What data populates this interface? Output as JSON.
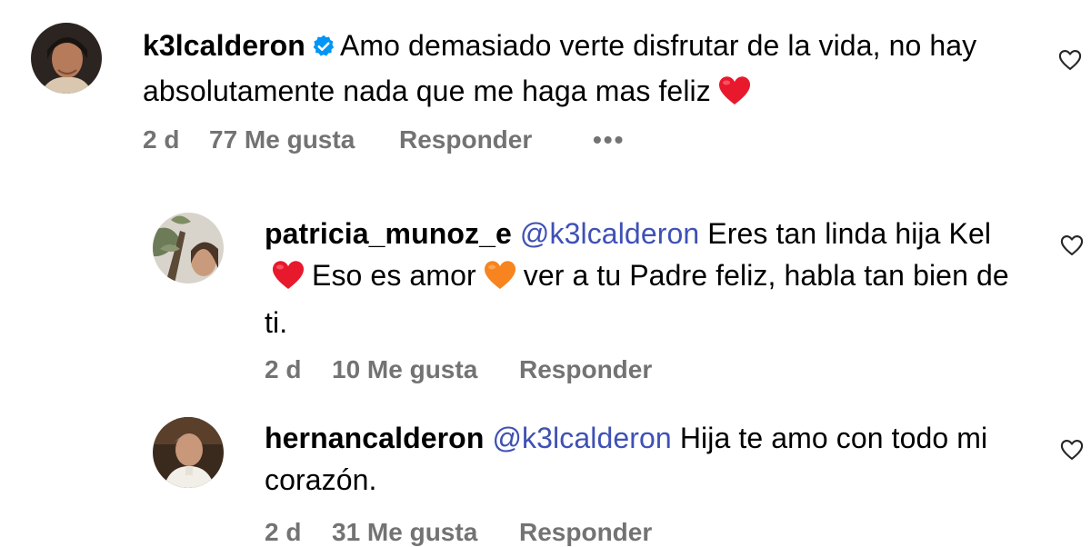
{
  "comments": [
    {
      "username": "k3lcalderon",
      "verified": true,
      "text": "Amo demasiado verte disfrutar de la vida, no hay absolutamente nada que me haga mas feliz",
      "trailing_emoji": "red-heart",
      "time": "2 d",
      "likes": "77 Me gusta",
      "reply_label": "Responder",
      "more_label": "•••"
    },
    {
      "username": "patricia_munoz_e",
      "mention": "@k3lcalderon",
      "text_part1": "Eres tan linda hija Kel",
      "emoji1": "red-heart",
      "text_part2": "Eso es amor",
      "emoji2": "orange-heart",
      "text_part3": "ver a tu Padre feliz, habla tan bien de ti.",
      "time": "2 d",
      "likes": "10 Me gusta",
      "reply_label": "Responder"
    },
    {
      "username": "hernancalderon",
      "mention": "@k3lcalderon",
      "text": "Hija te amo con todo mi corazón.",
      "time": "2 d",
      "likes": "31 Me gusta",
      "reply_label": "Responder"
    }
  ],
  "colors": {
    "meta": "#737373",
    "mention": "#3f51b5",
    "verified": "#0095f6",
    "heart_red": "#e8192c",
    "heart_orange": "#f7841e"
  },
  "icons": {
    "like": "heart-outline-icon",
    "verified": "verified-badge-icon"
  }
}
